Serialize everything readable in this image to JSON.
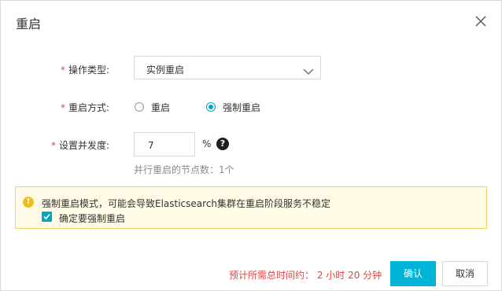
{
  "dialog": {
    "title": "重启",
    "close_icon": "close-icon"
  },
  "form": {
    "operation_type": {
      "required_mark": "*",
      "label": "操作类型:",
      "selected": "实例重启",
      "icon": "chevron-down-icon"
    },
    "restart_method": {
      "required_mark": "*",
      "label": "重启方式:",
      "options": [
        {
          "label": "重启",
          "checked": false
        },
        {
          "label": "强制重启",
          "checked": true
        }
      ]
    },
    "concurrency": {
      "required_mark": "*",
      "label": "设置并发度:",
      "value": "7",
      "unit": "%",
      "help_icon": "question-icon",
      "hint": "并行重启的节点数：1个"
    }
  },
  "warning": {
    "icon": "exclamation-icon",
    "text": "强制重启模式，可能会导致Elasticsearch集群在重启阶段服务不稳定",
    "checkbox_label": "确定要强制重启",
    "checkbox_checked": true
  },
  "footer": {
    "estimate": "预计所需总时间约： 2 小时 20 分钟",
    "ok_label": "确认",
    "cancel_label": "取消"
  },
  "colors": {
    "accent": "#00a7c7",
    "primary_button": "#00b4d8",
    "required": "#e04545",
    "warning_bg": "#fffbe6",
    "warning_icon": "#f2bd1c"
  }
}
